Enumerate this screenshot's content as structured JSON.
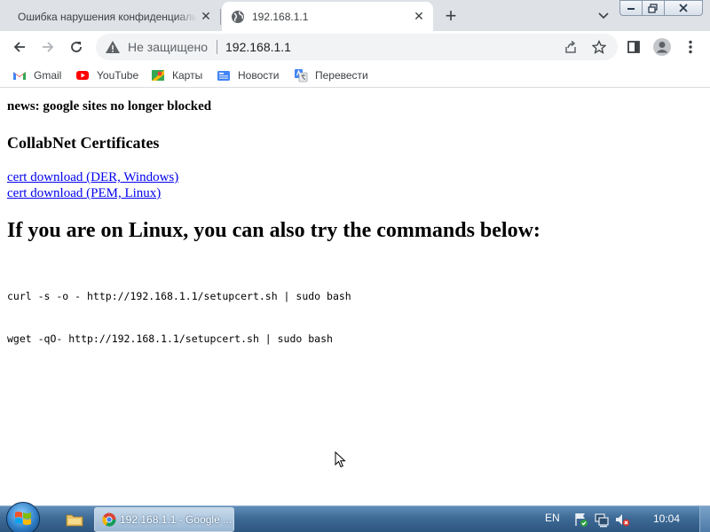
{
  "browser": {
    "tabs": [
      {
        "title": "Ошибка нарушения конфиденциальности",
        "active": false
      },
      {
        "title": "192.168.1.1",
        "active": true
      }
    ],
    "new_tab_symbol": "+",
    "close_symbol": "✕",
    "omnibox": {
      "security_label": "Не защищено",
      "url": "192.168.1.1"
    },
    "bookmarks": [
      {
        "label": "Gmail",
        "icon": "gmail-icon"
      },
      {
        "label": "YouTube",
        "icon": "youtube-icon"
      },
      {
        "label": "Карты",
        "icon": "maps-icon"
      },
      {
        "label": "Новости",
        "icon": "news-icon"
      },
      {
        "label": "Перевести",
        "icon": "translate-icon"
      }
    ]
  },
  "page": {
    "news": "news: google sites no longer blocked",
    "heading": "CollabNet Certificates",
    "links": [
      {
        "text": "cert download (DER, Windows)"
      },
      {
        "text": "cert download (PEM, Linux)"
      }
    ],
    "linux_heading": "If you are on Linux, you can also try the commands below:",
    "commands": [
      "curl -s -o - http://192.168.1.1/setupcert.sh | sudo bash",
      "wget -qO- http://192.168.1.1/setupcert.sh | sudo bash"
    ]
  },
  "taskbar": {
    "chrome_task_label": "192.168.1.1 - Google ...",
    "language": "EN",
    "clock": "10:04"
  },
  "colors": {
    "link": "#0000ee",
    "tabstrip": "#dee1e6",
    "omnibox": "#f1f3f4",
    "taskbar": "#3e6a96"
  }
}
